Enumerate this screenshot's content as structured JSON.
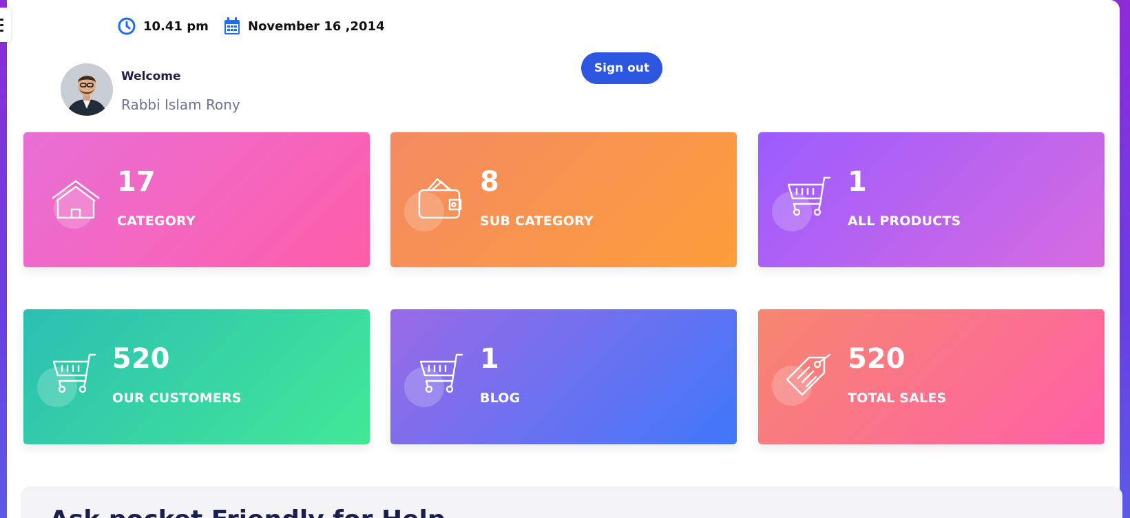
{
  "header": {
    "time": "10.41 pm",
    "date": "November 16 ,2014",
    "sign_out_label": "Sign out"
  },
  "user": {
    "welcome": "Welcome",
    "name": "Rabbi Islam Rony"
  },
  "cards": [
    {
      "value": "17",
      "label": "CATEGORY",
      "icon": "house-icon"
    },
    {
      "value": "8",
      "label": "SUB CATEGORY",
      "icon": "wallet-icon"
    },
    {
      "value": "1",
      "label": "ALL PRODUCTS",
      "icon": "cart-icon"
    },
    {
      "value": "520",
      "label": "OUR CUSTOMERS",
      "icon": "cart-icon"
    },
    {
      "value": "1",
      "label": "BLOG",
      "icon": "cart-icon"
    },
    {
      "value": "520",
      "label": "TOTAL SALES",
      "icon": "tag-icon"
    }
  ],
  "help": {
    "title": "Ask pocket Friendly for Help"
  },
  "colors": {
    "accent": "#2d56e0",
    "card_category": [
      "#e86fd6",
      "#ff5ea8"
    ],
    "card_sub_category": [
      "#f38a62",
      "#fd9e3a"
    ],
    "card_all_products": [
      "#9b5cff",
      "#d76be0"
    ],
    "card_customers": [
      "#2bbfb3",
      "#42e896"
    ],
    "card_blog": [
      "#9a6ae6",
      "#3f78fa"
    ],
    "card_total_sales": [
      "#f6876e",
      "#ff5fa8"
    ]
  }
}
